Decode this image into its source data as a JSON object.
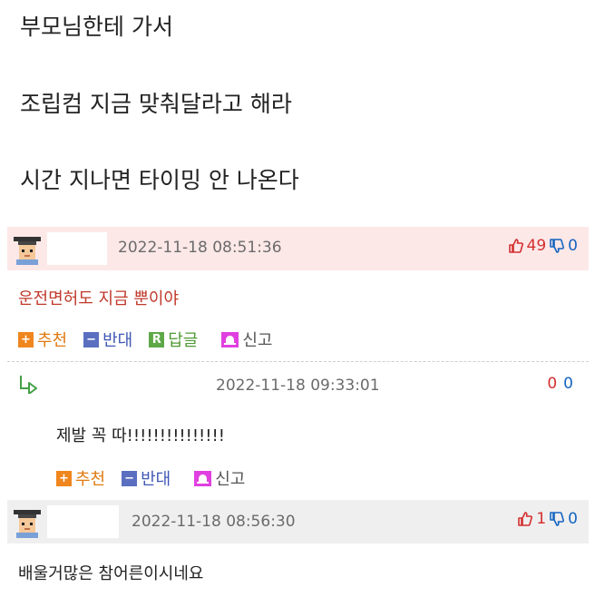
{
  "post": {
    "lines": [
      "부모님한테 가서",
      "조립컴 지금 맞춰달라고 해라",
      "시간 지나면 타이밍 안 나온다"
    ]
  },
  "comments": [
    {
      "timestamp": "2022-11-18 08:51:36",
      "up": "49",
      "down": "0",
      "text": "운전면허도 지금 뿐이야",
      "text_color": "#c0392b"
    },
    {
      "timestamp": "2022-11-18 08:56:30",
      "up": "1",
      "down": "0",
      "text": "배울거많은 참어른이시네요",
      "text_color": "#222222"
    }
  ],
  "reply": {
    "timestamp": "2022-11-18 09:33:01",
    "up": "0",
    "down": "0",
    "text": "제발 꼭 따!!!!!!!!!!!!!!!"
  },
  "actions": {
    "recommend": "추천",
    "oppose": "반대",
    "reply": "답글",
    "report": "신고"
  },
  "colors": {
    "header_pink": "#fde8e8",
    "header_gray": "#efefef",
    "up_red": "#d32f2f",
    "down_blue": "#1565c0"
  }
}
